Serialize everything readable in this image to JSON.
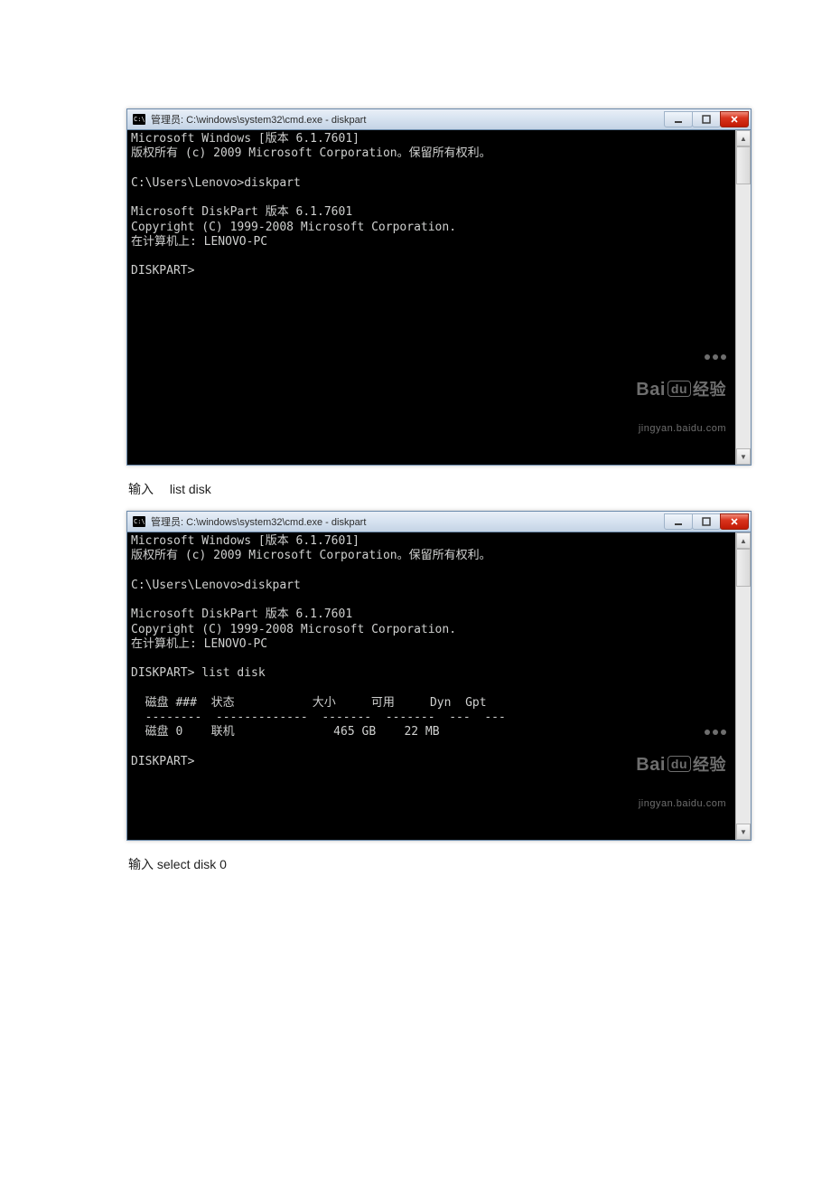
{
  "window1": {
    "title": "管理员: C:\\windows\\system32\\cmd.exe - diskpart",
    "min_label": "minimize",
    "max_label": "maximize",
    "close_label": "close"
  },
  "window2": {
    "title": "管理员: C:\\windows\\system32\\cmd.exe - diskpart"
  },
  "terminal1_text": "Microsoft Windows [版本 6.1.7601]\n版权所有 (c) 2009 Microsoft Corporation。保留所有权利。\n\nC:\\Users\\Lenovo>diskpart\n\nMicrosoft DiskPart 版本 6.1.7601\nCopyright (C) 1999-2008 Microsoft Corporation.\n在计算机上: LENOVO-PC\n\nDISKPART>",
  "terminal2_text": "Microsoft Windows [版本 6.1.7601]\n版权所有 (c) 2009 Microsoft Corporation。保留所有权利。\n\nC:\\Users\\Lenovo>diskpart\n\nMicrosoft DiskPart 版本 6.1.7601\nCopyright (C) 1999-2008 Microsoft Corporation.\n在计算机上: LENOVO-PC\n\nDISKPART> list disk\n\n  磁盘 ###  状态           大小     可用     Dyn  Gpt\n  --------  -------------  -------  -------  ---  ---\n  磁盘 0    联机              465 GB    22 MB\n\nDISKPART>",
  "caption1": "输入　 list disk",
  "caption2": "输入   select disk 0",
  "watermark": {
    "brand_prefix": "Bai",
    "brand_du": "du",
    "brand_suffix": "经验",
    "url": "jingyan.baidu.com"
  }
}
